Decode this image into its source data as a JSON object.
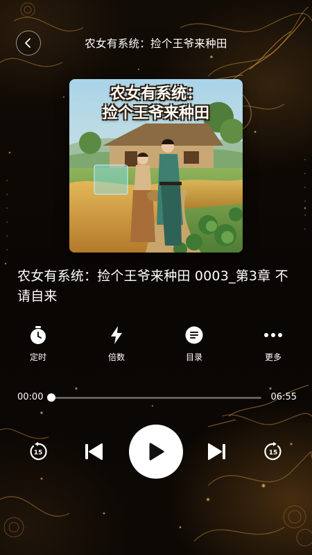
{
  "header": {
    "title": "农女有系统：捡个王爷来种田",
    "back_icon": "chevron-left-icon"
  },
  "cover": {
    "title_line1": "农女有系统：",
    "title_line2": "捡个王爷来种田"
  },
  "track": {
    "title": "农女有系统：捡个王爷来种田 0003_第3章 不请自来"
  },
  "actions": [
    {
      "label": "定时",
      "icon": "timer-icon"
    },
    {
      "label": "倍数",
      "icon": "speed-bolt-icon"
    },
    {
      "label": "目录",
      "icon": "list-icon"
    },
    {
      "label": "更多",
      "icon": "more-dots-icon"
    }
  ],
  "progress": {
    "current": "00:00",
    "duration": "06:55",
    "fraction": 0.0
  },
  "controls": {
    "rewind_seconds": "15",
    "forward_seconds": "15",
    "prev_icon": "skip-previous-icon",
    "play_icon": "play-icon",
    "next_icon": "skip-next-icon"
  },
  "colors": {
    "background": "#0b0704",
    "accent_gold": "#c8903a",
    "text": "#ffffff"
  }
}
